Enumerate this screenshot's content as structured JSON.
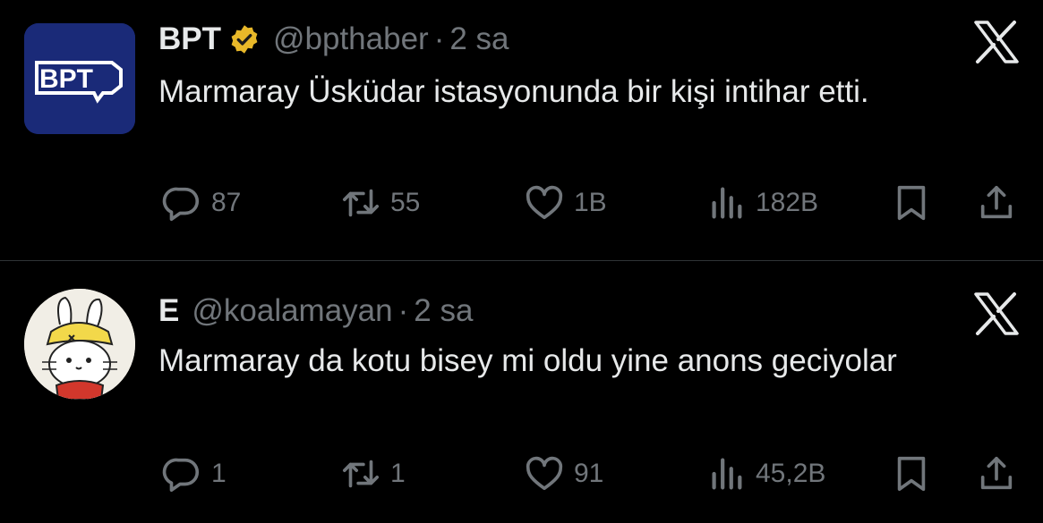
{
  "tweets": [
    {
      "display_name": "BPT",
      "handle": "@bpthaber",
      "separator": "·",
      "time": "2 sa",
      "text": "Marmaray Üsküdar istasyonunda bir kişi intihar etti.",
      "verified": true,
      "avatar_text": "BPT",
      "stats": {
        "replies": "87",
        "reposts": "55",
        "likes": "1B",
        "views": "182B"
      }
    },
    {
      "display_name": "E",
      "handle": "@koalamayan",
      "separator": "·",
      "time": "2 sa",
      "text": "Marmaray da kotu bisey mi oldu yine anons geciyolar",
      "verified": false,
      "stats": {
        "replies": "1",
        "reposts": "1",
        "likes": "91",
        "views": "45,2B"
      }
    }
  ],
  "colors": {
    "background": "#000000",
    "text_primary": "#e7e9ea",
    "text_secondary": "#71767b",
    "divider": "#2f3336",
    "verified_gold": "#e8b829",
    "bpt_avatar_blue": "#1a2a78"
  },
  "icons": [
    "bpt-logo-icon",
    "verified-badge-icon",
    "x-logo-icon",
    "reply-icon",
    "repost-icon",
    "like-icon",
    "views-icon",
    "bookmark-icon",
    "share-icon"
  ]
}
